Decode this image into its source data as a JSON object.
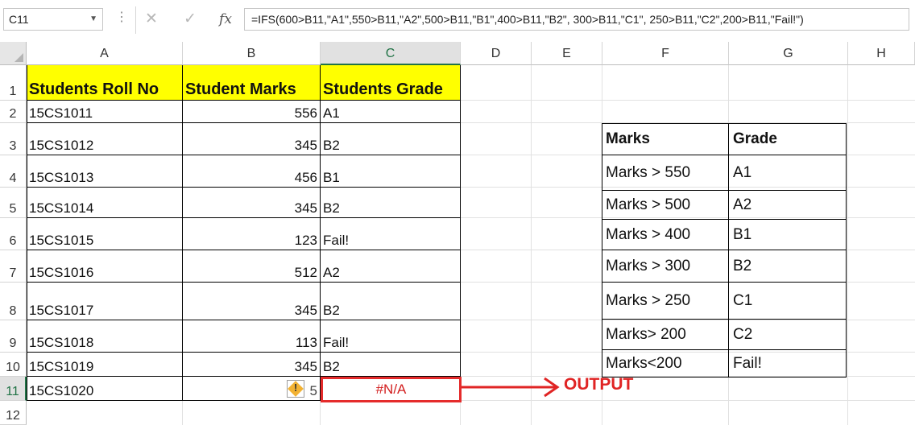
{
  "formula_bar": {
    "name_box": "C11",
    "cancel_icon": "✕",
    "enter_icon": "✓",
    "fx_label": "fx",
    "formula": "=IFS(600>B11,\"A1\",550>B11,\"A2\",500>B11,\"B1\",400>B11,\"B2\", 300>B11,\"C1\", 250>B11,\"C2\",200>B11,\"Fail!\")"
  },
  "columns": [
    "A",
    "B",
    "C",
    "D",
    "E",
    "F",
    "G",
    "H"
  ],
  "rows": [
    "1",
    "2",
    "3",
    "4",
    "5",
    "6",
    "7",
    "8",
    "9",
    "10",
    "11",
    "12"
  ],
  "selected_cell": {
    "column": "C",
    "row": "11"
  },
  "table": {
    "headers": [
      "Students Roll No",
      "Student Marks",
      "Students Grade"
    ],
    "rows": [
      [
        "15CS1011",
        "556",
        "A1"
      ],
      [
        "15CS1012",
        "345",
        "B2"
      ],
      [
        "15CS1013",
        "456",
        "B1"
      ],
      [
        "15CS1014",
        "345",
        "B2"
      ],
      [
        "15CS1015",
        "123",
        "Fail!"
      ],
      [
        "15CS1016",
        "512",
        "A2"
      ],
      [
        "15CS1017",
        "345",
        "B2"
      ],
      [
        "15CS1018",
        "113",
        "Fail!"
      ],
      [
        "15CS1019",
        "345",
        "B2"
      ],
      [
        "15CS1020",
        "5",
        "#N/A"
      ]
    ]
  },
  "reference_table": {
    "headers": [
      "Marks",
      "Grade"
    ],
    "rows": [
      [
        "Marks > 550",
        "A1"
      ],
      [
        "Marks > 500",
        "A2"
      ],
      [
        "Marks > 400",
        "B1"
      ],
      [
        "Marks > 300",
        "B2"
      ],
      [
        "Marks > 250",
        "C1"
      ],
      [
        "Marks> 200",
        "C2"
      ],
      [
        "Marks<200",
        "Fail!"
      ]
    ]
  },
  "annotation": {
    "label": "OUTPUT",
    "color": "#e02424"
  },
  "icons": {
    "error_indicator": "warning-diamond-icon",
    "arrow": "right-arrow-icon"
  }
}
